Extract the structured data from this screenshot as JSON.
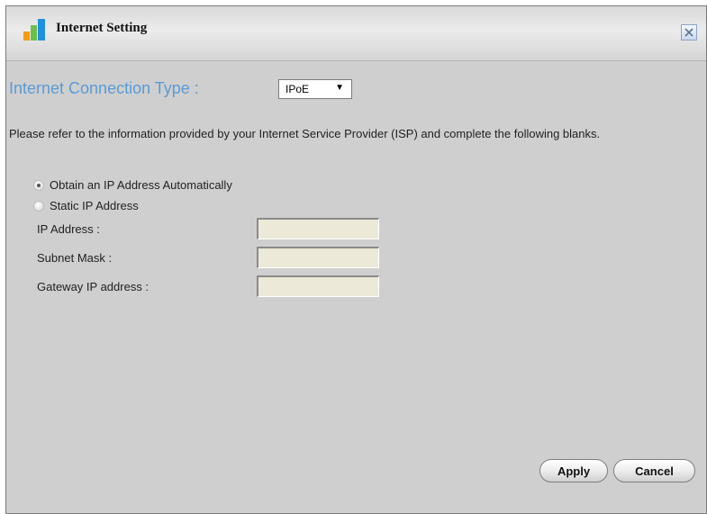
{
  "dialog": {
    "title": "Internet Setting",
    "close_icon": "close-icon",
    "app_icon": "signal-bars-icon"
  },
  "connection": {
    "label": "Internet Connection Type :",
    "selected": "IPoE"
  },
  "description": "Please refer to the information provided by your Internet Service Provider (ISP) and complete the following blanks.",
  "options": {
    "auto": "Obtain an IP Address Automatically",
    "static": "Static IP Address",
    "selected": "auto"
  },
  "fields": {
    "ip_label": "IP Address :",
    "ip_value": "",
    "mask_label": "Subnet Mask :",
    "mask_value": "",
    "gateway_label": "Gateway IP address :",
    "gateway_value": ""
  },
  "buttons": {
    "apply": "Apply",
    "cancel": "Cancel"
  },
  "colors": {
    "accent": "#5b9bd5",
    "background": "#cfcfcf"
  }
}
